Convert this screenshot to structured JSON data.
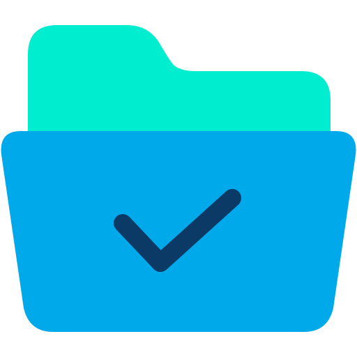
{
  "icon": {
    "name": "folder-check-icon",
    "colors": {
      "folder_back": "#00EDD0",
      "folder_front": "#00A9EA",
      "checkmark": "#0B3A66"
    }
  }
}
